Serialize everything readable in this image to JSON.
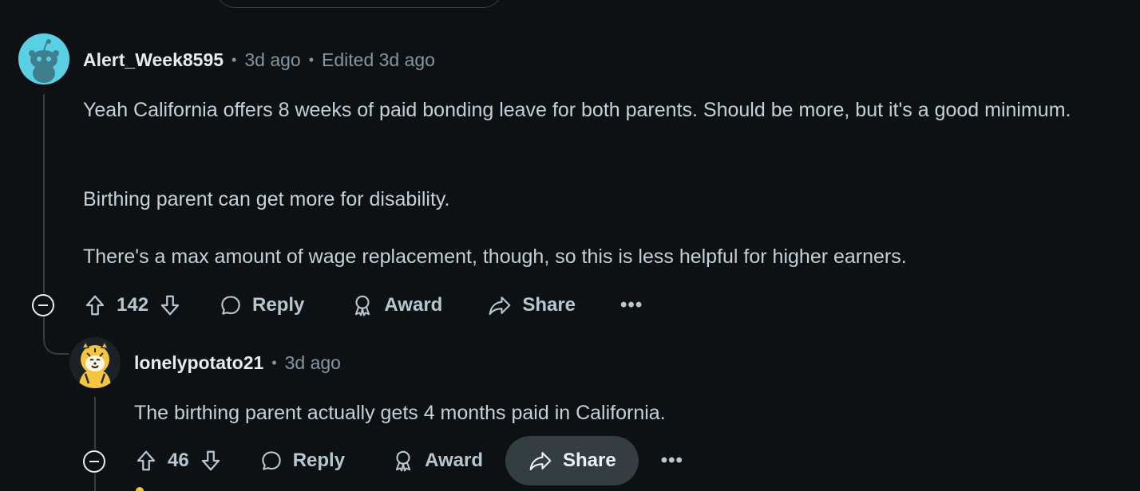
{
  "comments": [
    {
      "username": "Alert_Week8595",
      "time": "3d ago",
      "edited": "Edited 3d ago",
      "paragraphs": [
        "Yeah California offers 8 weeks of paid bonding leave for both parents. Should be more, but it's a good minimum.",
        "Birthing parent can get more for disability.",
        "There's a max amount of wage replacement, though, so this is less helpful for higher earners."
      ],
      "votes": "142",
      "reply_label": "Reply",
      "award_label": "Award",
      "share_label": "Share",
      "more_label": "•••"
    },
    {
      "username": "lonelypotato21",
      "time": "3d ago",
      "paragraphs": [
        "The birthing parent actually gets 4 months paid in California."
      ],
      "votes": "46",
      "reply_label": "Reply",
      "award_label": "Award",
      "share_label": "Share",
      "more_label": "•••"
    }
  ],
  "meta_separator": "•",
  "icons": [
    "avatar-snoo-icon",
    "collapse-icon",
    "upvote-icon",
    "downvote-icon",
    "reply-icon",
    "award-icon",
    "share-icon",
    "more-icon"
  ],
  "colors": {
    "background": "#0e1113",
    "text": "#c5d1d8",
    "muted": "#8696a0",
    "share_hover": "#333d42"
  }
}
